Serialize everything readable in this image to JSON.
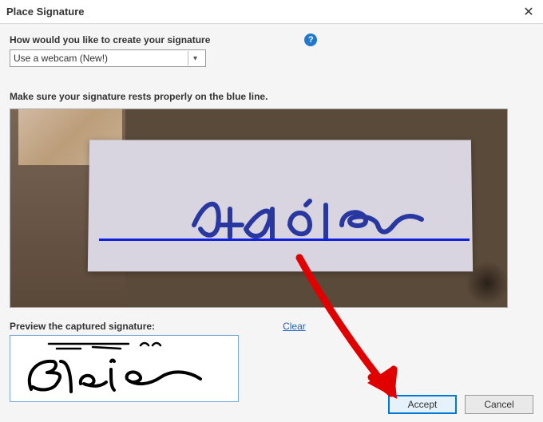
{
  "dialog": {
    "title": "Place Signature"
  },
  "question_label": "How would you like to create your signature",
  "dropdown": {
    "selected": "Use a webcam (New!)"
  },
  "instruction": "Make sure your signature rests properly on the blue line.",
  "preview": {
    "label": "Preview the captured signature:",
    "clear": "Clear"
  },
  "buttons": {
    "accept": "Accept",
    "cancel": "Cancel"
  }
}
